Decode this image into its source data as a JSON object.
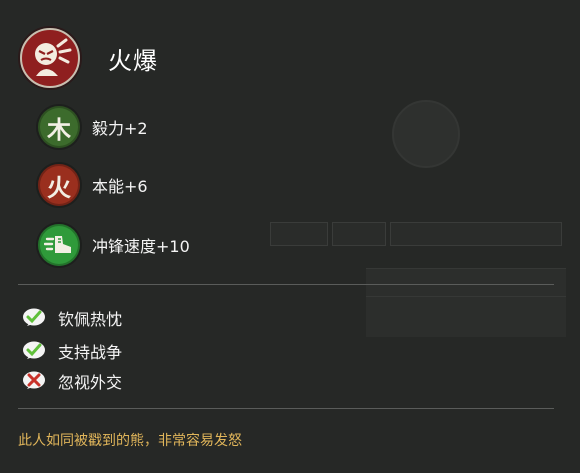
{
  "character": {
    "name": "火爆",
    "portrait_icon": "angry-face-icon",
    "portrait_color": "#8f1f1f"
  },
  "stats": [
    {
      "glyph": "木",
      "label": "毅力+2",
      "color": "#3c6b2c",
      "icon": "wood-element-icon"
    },
    {
      "glyph": "火",
      "label": "本能+6",
      "color": "#9a2f1e",
      "icon": "fire-element-icon"
    },
    {
      "glyph": "",
      "label": "冲锋速度+10",
      "color": "#2f9a3a",
      "icon": "charge-boot-icon"
    }
  ],
  "traits": [
    {
      "label": "钦佩热忱",
      "kind": "positive",
      "icon": "check-icon"
    },
    {
      "label": "支持战争",
      "kind": "positive",
      "icon": "check-icon"
    },
    {
      "label": "忽视外交",
      "kind": "negative",
      "icon": "cross-icon"
    }
  ],
  "description": "此人如同被戳到的熊，非常容易发怒",
  "colors": {
    "background": "#262826",
    "description_text": "#e0b55a",
    "positive": "#5fbf3a",
    "negative": "#c8322a"
  }
}
